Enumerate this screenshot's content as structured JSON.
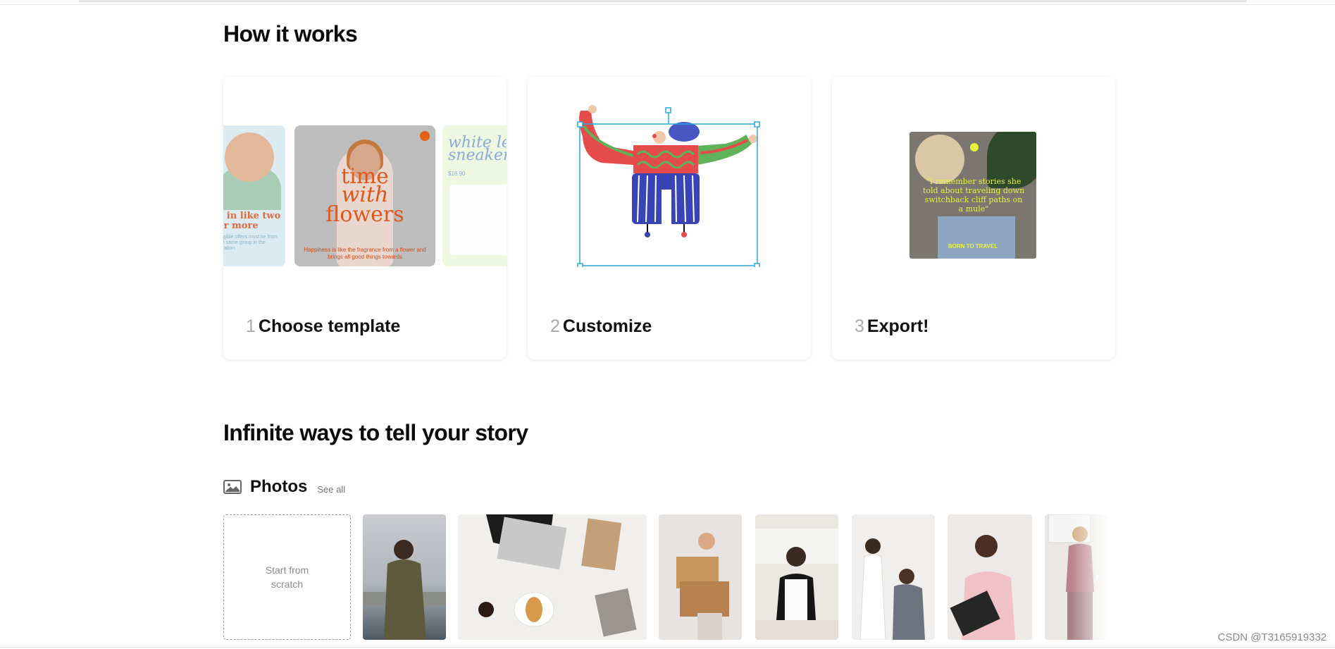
{
  "how_it_works": {
    "title": "How it works",
    "steps": [
      {
        "number": "1",
        "label": "Choose template"
      },
      {
        "number": "2",
        "label": "Customize"
      },
      {
        "number": "3",
        "label": "Export!"
      }
    ],
    "template_previews": {
      "left_text": "e in like two or more",
      "left_small": "Eligible offers must be from the same group in the location",
      "main_text_line1": "time",
      "main_text_line2": "with",
      "main_text_line3": "flowers",
      "main_small": "Happiness is like the fragrance from a flower and brings all good things towards",
      "right_text": "white le sneaker",
      "right_price": "$16.90"
    },
    "export_preview": {
      "quote": "\"I remember stories she told about traveling down switchback cliff paths on a mule\"",
      "tag": "BORN TO TRAVEL"
    }
  },
  "infinite": {
    "title": "Infinite ways to tell your story"
  },
  "photos": {
    "icon": "image-icon",
    "label": "Photos",
    "see_all": "See all",
    "start_from_scratch": "Start from scratch",
    "next_arrow": "›"
  },
  "watermark": "CSDN @T3165919332",
  "colors": {
    "accent_blue": "#29a8e0",
    "template_orange": "#e0571a",
    "export_yellow": "#e6f23a"
  }
}
